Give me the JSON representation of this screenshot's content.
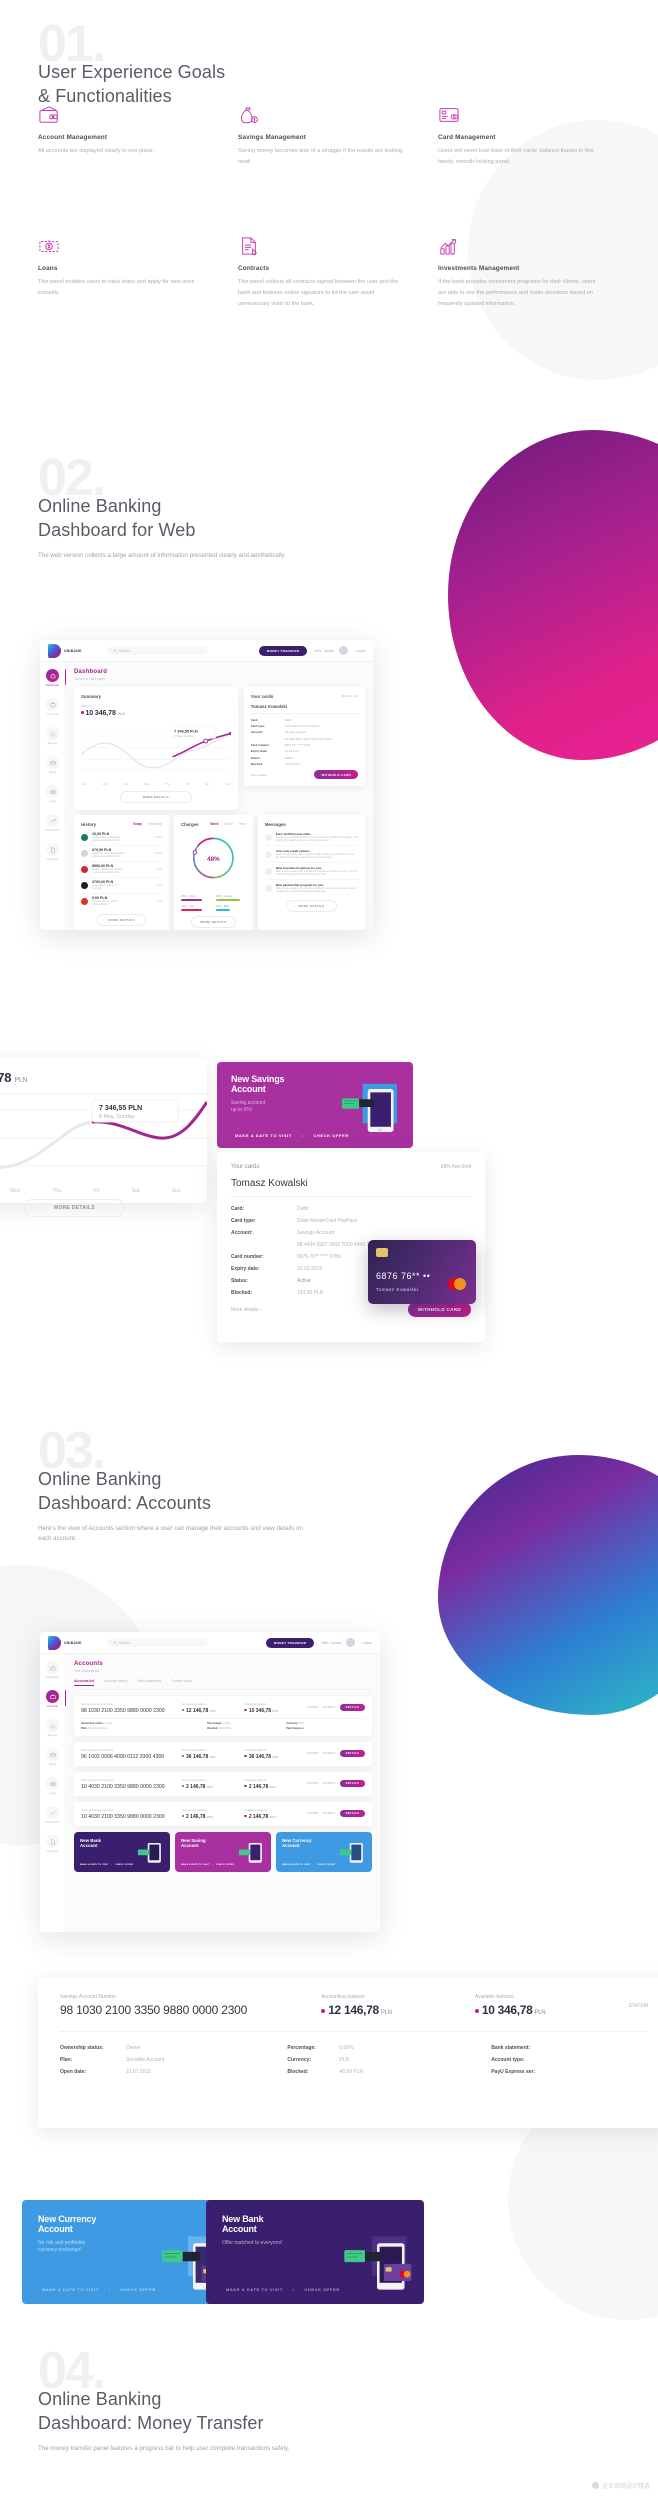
{
  "sections": [
    {
      "number": "01.",
      "title_line1": "User Experience Goals",
      "title_line2": "& Functionalities"
    },
    {
      "number": "02.",
      "title_line1": "Online Banking",
      "title_line2": "Dashboard for Web",
      "subtitle": "The web version collects a large amount of information presented clearly and aesthetically."
    },
    {
      "number": "03.",
      "title_line1": "Online Banking",
      "title_line2": "Dashboard: Accounts",
      "subtitle": "Here's the view of Accounts section where a user can manage their accounts and view details on each account."
    },
    {
      "number": "04.",
      "title_line1": "Online Banking",
      "title_line2": "Dashboard: Money Transfer",
      "subtitle": "The money transfer panel features a progress bar to help user complete transactions safely."
    }
  ],
  "features": [
    {
      "icon": "wallet-icon",
      "title": "Account Management",
      "desc": "All accounts are displayed clearly in one place."
    },
    {
      "icon": "money-bag-icon",
      "title": "Savings Management",
      "desc": "Saving money becomes less of a struggle if the results are looking neat!"
    },
    {
      "icon": "credit-card-icon",
      "title": "Card Management",
      "desc": "Users will never lose track of their cards' balance thanks to this handy, smooth-looking panel."
    },
    {
      "icon": "loan-icon",
      "title": "Loans",
      "desc": "This panel enables users to track loans and apply for new ones instantly."
    },
    {
      "icon": "contract-icon",
      "title": "Contracts",
      "desc": "This panel collects all contracts signed between the user and the bank and features online signature to let the user avoid unnecessary visits to the bank."
    },
    {
      "icon": "chart-up-icon",
      "title": "Investments Management",
      "desc": "If the bank provides investment programs for their clients, users are able to see the performance and make decisions based on frequently updated information."
    }
  ],
  "brand": {
    "logo_text": "UNIBANK",
    "accent": "#c1208d",
    "purple": "#3a1f6e",
    "blue": "#3d9ae3"
  },
  "dashboard": {
    "search_placeholder": "Search...",
    "money_transfer_button": "MONEY TRANSFER",
    "greeting": "Hello, Tomasz",
    "logout": "Logout",
    "page_title": "Dashboard",
    "page_subtitle": "You are in main panel",
    "nav": [
      {
        "label": "Dashboard",
        "icon": "home-icon",
        "active": true
      },
      {
        "label": "Accounts",
        "icon": "wallet-icon",
        "active": false
      },
      {
        "label": "Savings",
        "icon": "money-bag-icon",
        "active": false
      },
      {
        "label": "Cards",
        "icon": "credit-card-icon",
        "active": false
      },
      {
        "label": "Loans",
        "icon": "loan-icon",
        "active": false
      },
      {
        "label": "Investments",
        "icon": "chart-up-icon",
        "active": false
      },
      {
        "label": "Contracts",
        "icon": "contract-icon",
        "active": false
      }
    ],
    "summary": {
      "title": "Summary",
      "balance_label": "Balance",
      "balance_value": "10 346,78",
      "currency": "PLN",
      "tooltip_value": "7 346,55 PLN",
      "tooltip_date": "8 May, Sunday",
      "axis_days": [
        "Sun",
        "Mon",
        "Tue",
        "Wed",
        "Thu",
        "Fri",
        "Sat",
        "Sun",
        "Mon"
      ],
      "more_details": "MORE DETAILS"
    },
    "your_cards": {
      "title": "Your cards",
      "badge": "68% free limit",
      "owner": "Tomasz Kowalski",
      "rows": [
        {
          "label": "Card:",
          "value": "Debit"
        },
        {
          "label": "Card type:",
          "value": "Debit MasterCard PayPass"
        },
        {
          "label": "Account:",
          "value": "Savings Account"
        },
        {
          "label": "",
          "value": "68 4434 5567 0000 7000 5442 3789"
        },
        {
          "label": "Card number:",
          "value": "6876 76** **** 0789"
        },
        {
          "label": "Expiry date:",
          "value": "31.03.2019"
        },
        {
          "label": "Status:",
          "value": "Active",
          "status": true
        },
        {
          "label": "Blocked:",
          "value": "743,00 PLN"
        }
      ],
      "more_details": "More details ›",
      "withhold_button": "WITHHOLD CARD",
      "card_face": {
        "number": "6876  76**  ••",
        "name": "Tomasz  Kowalski"
      }
    },
    "history": {
      "title": "History",
      "tabs": [
        "Today",
        "Yesterday"
      ],
      "active_tab": "Today",
      "items": [
        {
          "amount": "16,00 PLN",
          "sign": "-",
          "merchant": "Coffee Latte - Starbucks",
          "place": "1 Aleja Jana Pawla II 61",
          "time": "12:45",
          "color": "#1a7a4c"
        },
        {
          "amount": "679,99 PLN",
          "sign": "-",
          "merchant": "Multifunc. Lamp Fotografika",
          "place": "1 Aleja Jana Pawla II 61",
          "time": "10:32",
          "color": "#9aa0ab"
        },
        {
          "amount": "8500,00 PLN",
          "sign": "+",
          "merchant": "Netflix - dashboard design",
          "place": "1 Los Gatos, California",
          "time": "9:00",
          "color": "#d6222b"
        },
        {
          "amount": "3700,00 PLN",
          "sign": "-",
          "merchant": "Apple iPad - iphone 7",
          "place": "1 A Kalis",
          "time": "8:45",
          "color": "#1b1b1b"
        },
        {
          "amount": "9,00 PLN",
          "sign": "-",
          "merchant": "Fotryka Formy - pl.ulic",
          "place": "3 Rtonski DNZ",
          "time": "7:20",
          "color": "#e0322c"
        }
      ],
      "more_details": "MORE DETAILS"
    },
    "charges": {
      "title": "Charges",
      "tabs": [
        "Week",
        "Month",
        "Year"
      ],
      "active_tab": "Week",
      "center_value": "48%",
      "legend": [
        {
          "pct": "26%",
          "label": "Food",
          "color": "#9b2fa0"
        },
        {
          "pct": "31%",
          "label": "House",
          "color": "#8dc63f"
        },
        {
          "pct": "27%",
          "label": "Car",
          "color": "#ec1a63"
        },
        {
          "pct": "16%",
          "label": "Bills",
          "color": "#2bbccf"
        }
      ],
      "more_details": "MORE DETAILS"
    },
    "messages": {
      "title": "Messages",
      "items": [
        {
          "title": "Earn 10.000 bonus miles",
          "desc": "Activate your promotional code now for an access to Miles Plus program. You can fly right inside luxury once of its origin amount."
        },
        {
          "title": "Your new credit options",
          "desc": "Check out the newly added options to help manage your finances in a way the bank wouldn't have expected from a regular bank."
        },
        {
          "title": "New investment options for you",
          "desc": "Take a look at saving with a helpful and handy set of features to put, it be the off when the products are planned at a fair rate."
        },
        {
          "title": "New partnership program for you",
          "desc": "Take a look at saving with a helpful and handy set of features to put, it be the off when the products are planned at a fair rate."
        }
      ],
      "more_details": "MORE DETAILS"
    },
    "promo_savings": {
      "title_line1": "New Savings",
      "title_line2": "Account",
      "desc_line1": "Saving account",
      "desc_line2": "up to 6%!",
      "cta1": "MAKE A DATE TO VISIT",
      "cta2": "CHECK OFFER",
      "color": "#a8309f"
    }
  },
  "accounts": {
    "page_title": "Accounts",
    "page_subtitle": "Your accounts list",
    "tabs": [
      "Accounts list",
      "Accounts history",
      "Bank statements",
      "Transfer salary"
    ],
    "active_tab": "Accounts list",
    "column_headers": [
      "Savings Account Number",
      "Accounting balance",
      "Available balance"
    ],
    "rows": [
      {
        "label": "Savings Account Number",
        "number": "98 1030 2100 3350 9880 0000 2300",
        "accounting_label": "Accounting balance",
        "accounting": "12 146,78",
        "available_label": "Available balance",
        "available": "10 346,78",
        "currency": "PLN",
        "btn_history": "HISTORY",
        "btn_payment": "PAYMENT",
        "btn_details": "DETAILS"
      },
      {
        "label": "Savings Account Number",
        "number": "96 1002 0006 4090 0112 3300 4300",
        "accounting_label": "Accounting balance",
        "accounting": "36 146,78",
        "available_label": "Available balance",
        "available": "36 146,78",
        "currency": "PLN",
        "btn_history": "HISTORY",
        "btn_payment": "PAYMENT",
        "btn_details": "DETAILS"
      },
      {
        "label": "Savings Account Number",
        "number": "10 4030 2100 3350 9880 0000 2300",
        "accounting_label": "Accounting balance",
        "accounting": "2 146,78",
        "available_label": "Available balance",
        "available": "2 146,78",
        "currency": "PLN",
        "btn_history": "HISTORY",
        "btn_payment": "PAYMENT",
        "btn_details": "DETAILS"
      },
      {
        "label": "Savings Account Number",
        "number": "10 4030 2100 3350 9880 0000 2300",
        "accounting_label": "Accounting balance",
        "accounting": "2 146,78",
        "available_label": "Available balance",
        "available": "2 146,78",
        "currency": "PLN",
        "btn_history": "HISTORY",
        "btn_payment": "PAYMENT",
        "btn_details": "DETAILS"
      }
    ],
    "promos": [
      {
        "title_line1": "New Bank",
        "title_line2": "Account",
        "color": "#3a1f6e",
        "cta1": "MAKE A DATE TO VISIT",
        "cta2": "CHECK OFFER"
      },
      {
        "title_line1": "New Saving",
        "title_line2": "Account",
        "color": "#a8309f",
        "cta1": "MAKE A DATE TO VISIT",
        "cta2": "CHECK OFFER"
      },
      {
        "title_line1": "New Currency",
        "title_line2": "Account",
        "color": "#3d9ae3",
        "cta1": "MAKE A DATE TO VISIT",
        "cta2": "CHECK OFFER"
      }
    ]
  },
  "detail_strip": {
    "account_label": "Savings Account Number",
    "account_number": "98 1030 2100 3350 9880 0000 2300",
    "accounting_label": "Accounting balance",
    "accounting_value": "12 146,78",
    "available_label": "Available balance",
    "available_value": "10 346,78",
    "currency": "PLN",
    "statement_link": "STATEM",
    "col1": [
      {
        "label": "Ownership status:",
        "value": "Owner"
      },
      {
        "label": "Plan:",
        "value": "Sensible Account"
      },
      {
        "label": "Open date:",
        "value": "21.07.2011"
      }
    ],
    "col2": [
      {
        "label": "Percentage:",
        "value": "0,00%"
      },
      {
        "label": "Currency:",
        "value": "PLN"
      },
      {
        "label": "Blocked:",
        "value": "46,99 PLN"
      }
    ],
    "col3": [
      {
        "label": "Bank statement:",
        "value": ""
      },
      {
        "label": "Account type:",
        "value": ""
      },
      {
        "label": "PayU Express ser:",
        "value": ""
      }
    ]
  },
  "bottom_promos": [
    {
      "title_line1": "New Currency",
      "title_line2": "Account",
      "desc_line1": "No risk and profitable",
      "desc_line2": "currency exchange!",
      "cta1": "MAKE A DATE TO VISIT",
      "cta2": "CHECK OFFER",
      "color": "#3d9ae3"
    },
    {
      "title_line1": "New Bank",
      "title_line2": "Account",
      "desc_line1": "Offer matched to everyone!",
      "desc_line2": "",
      "cta1": "MAKE A DATE TO VISIT",
      "cta2": "CHECK OFFER",
      "color": "#3a1f6e"
    }
  ],
  "watermark": "企业官网设计精选"
}
